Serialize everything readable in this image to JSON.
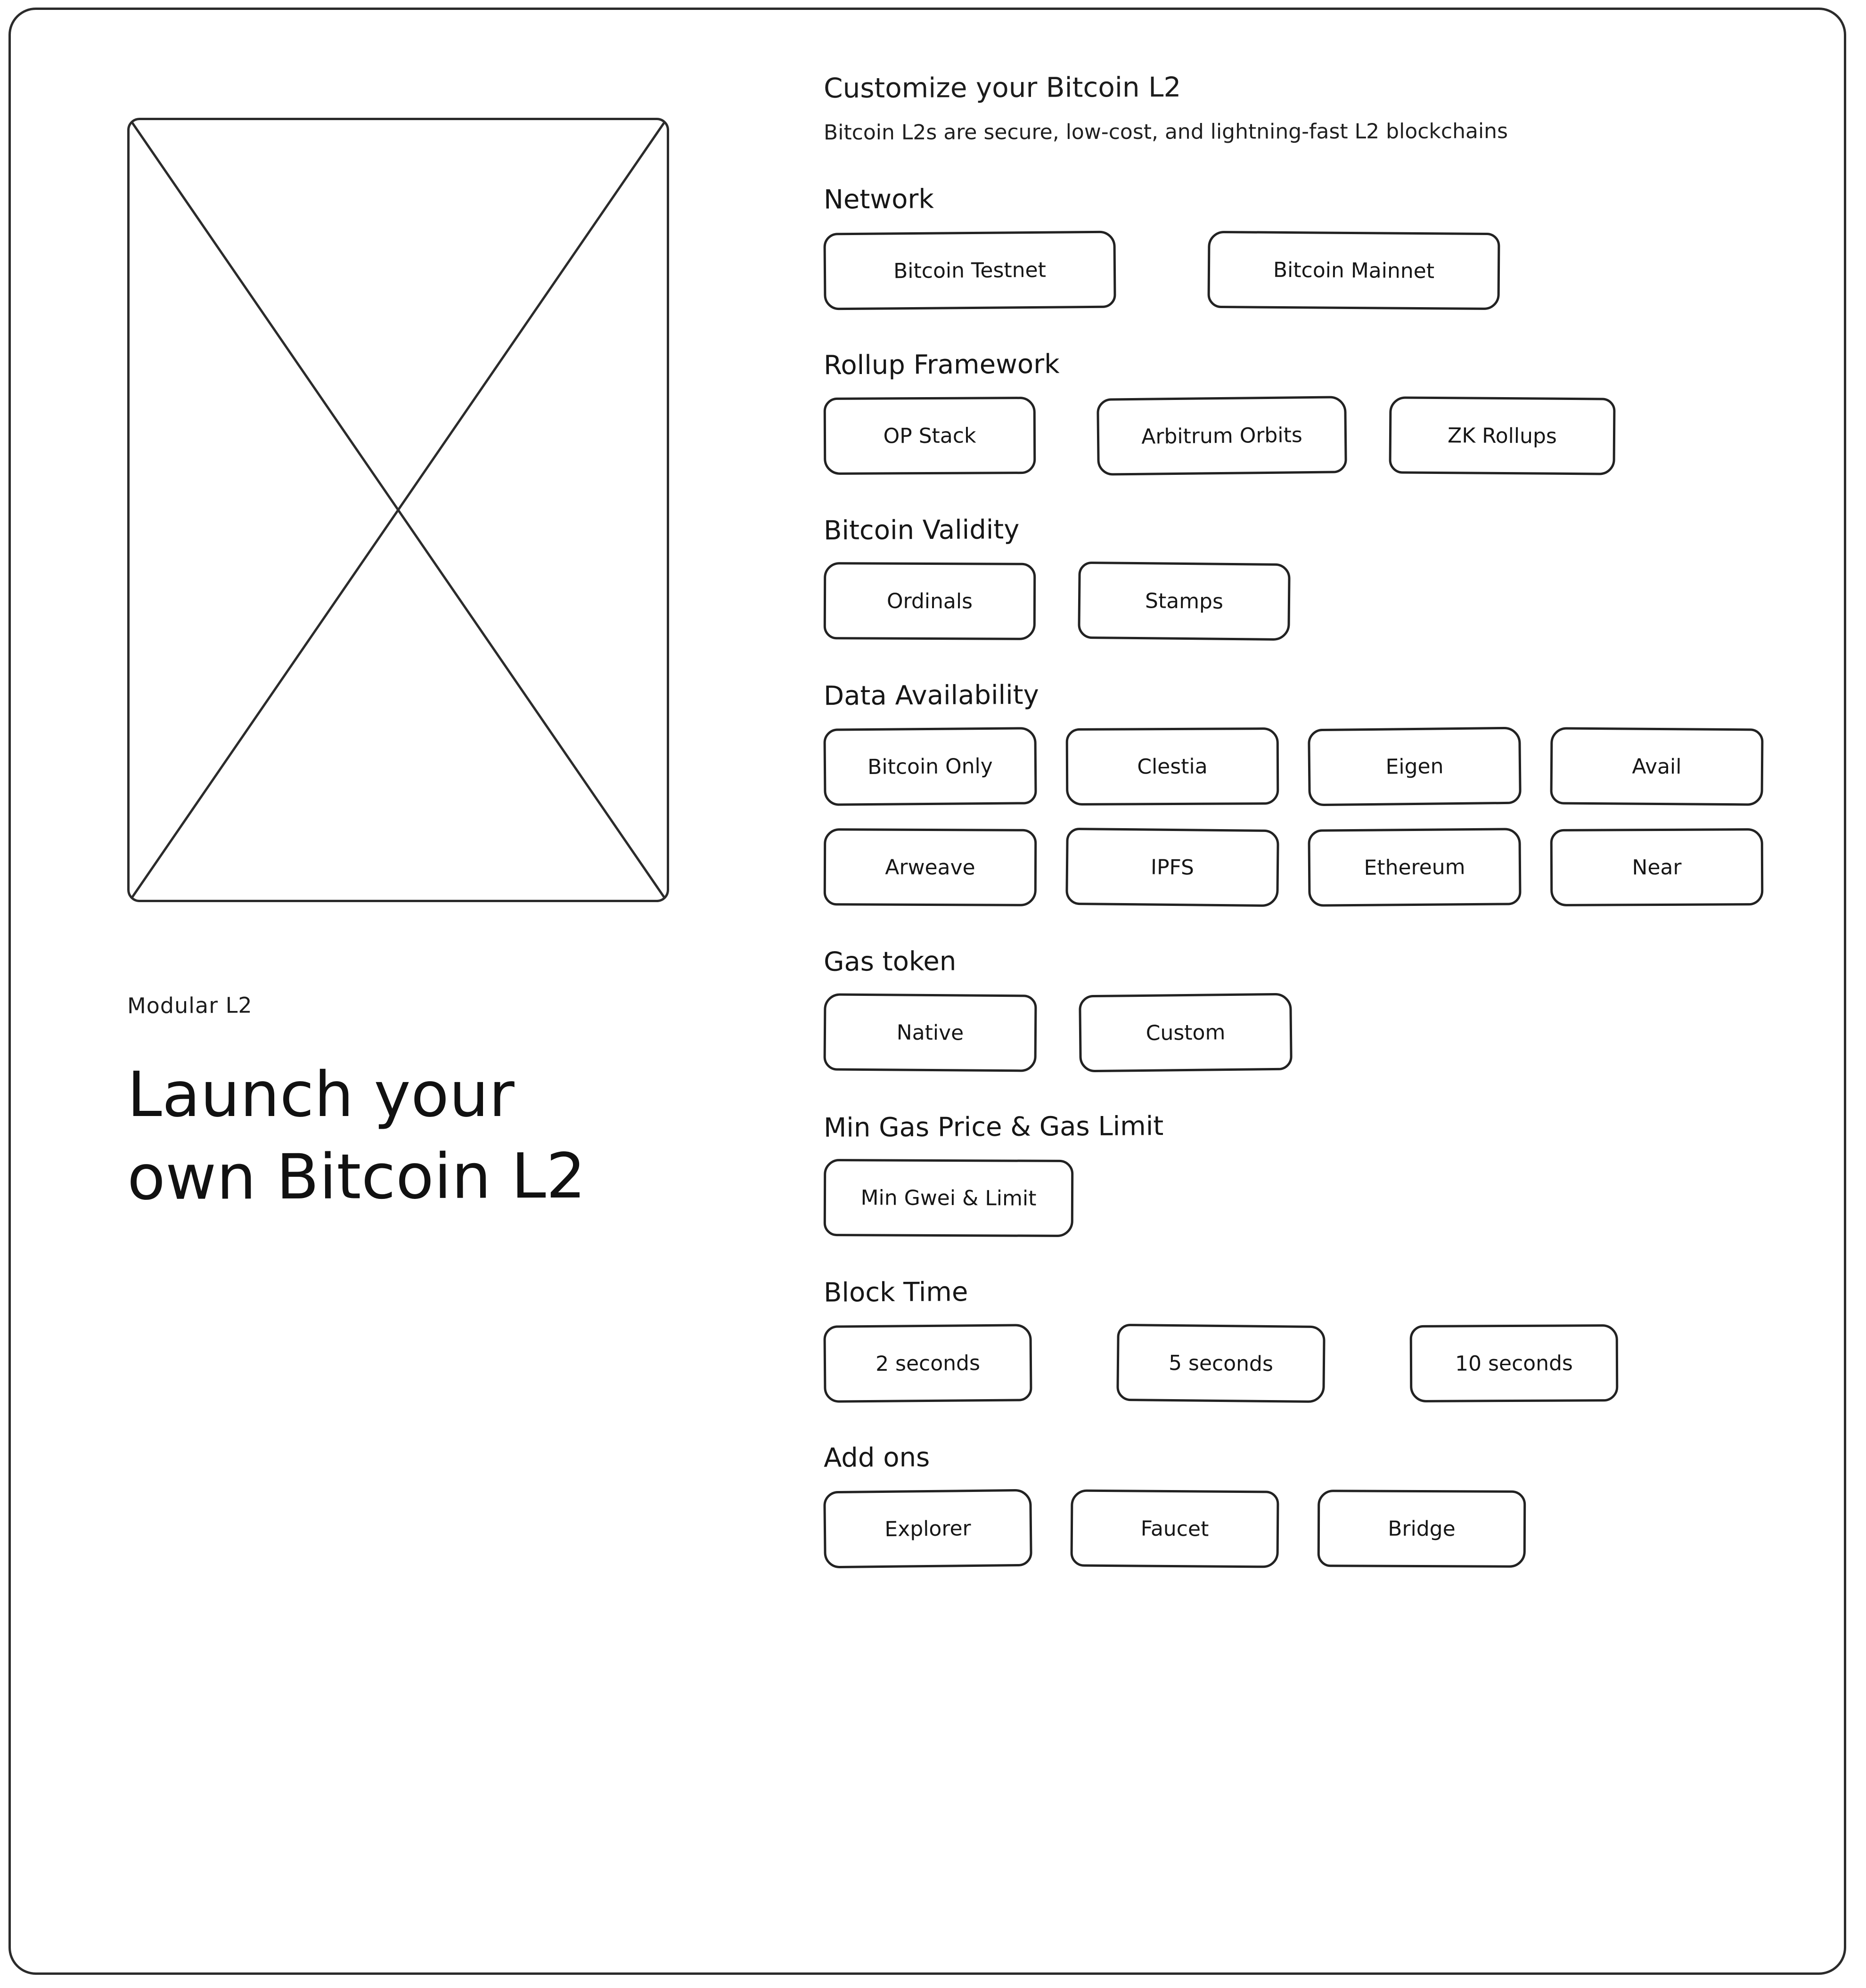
{
  "hero": {
    "eyebrow": "Modular L2",
    "headline_line_1": "Launch your",
    "headline_line_2": "own Bitcoin L2",
    "image_placeholder_name": "image-placeholder"
  },
  "panel": {
    "title": "Customize your Bitcoin L2",
    "subtitle": "Bitcoin L2s are secure, low-cost, and lightning-fast L2 blockchains"
  },
  "sections": {
    "network": {
      "label": "Network",
      "options": [
        "Bitcoin Testnet",
        "Bitcoin Mainnet"
      ]
    },
    "rollup_framework": {
      "label": "Rollup Framework",
      "options": [
        "OP Stack",
        "Arbitrum Orbits",
        "ZK Rollups"
      ]
    },
    "bitcoin_validity": {
      "label": "Bitcoin Validity",
      "options": [
        "Ordinals",
        "Stamps"
      ]
    },
    "data_availability": {
      "label": "Data Availability",
      "row1": [
        "Bitcoin Only",
        "Clestia",
        "Eigen",
        "Avail"
      ],
      "row2": [
        "Arweave",
        "IPFS",
        "Ethereum",
        "Near"
      ]
    },
    "gas_token": {
      "label": "Gas token",
      "options": [
        "Native",
        "Custom"
      ]
    },
    "gas_price_limit": {
      "label": "Min Gas Price & Gas Limit",
      "options": [
        "Min Gwei & Limit"
      ]
    },
    "block_time": {
      "label": "Block Time",
      "options": [
        "2 seconds",
        "5 seconds",
        "10 seconds"
      ]
    },
    "add_ons": {
      "label": "Add ons",
      "options": [
        "Explorer",
        "Faucet",
        "Bridge"
      ]
    }
  },
  "colors": {
    "stroke": "#222222",
    "text": "#161616",
    "background": "#ffffff"
  }
}
